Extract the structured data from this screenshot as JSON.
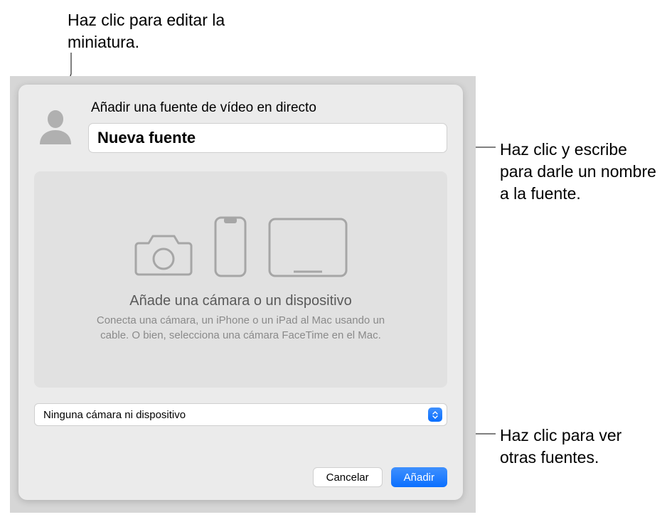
{
  "callouts": {
    "top": "Haz clic para editar la miniatura.",
    "right1": "Haz clic y escribe para darle un nombre a la fuente.",
    "right2": "Haz clic para ver otras fuentes."
  },
  "dialog": {
    "title": "Añadir una fuente de vídeo en directo",
    "name_value": "Nueva fuente",
    "preview_heading": "Añade una cámara o un dispositivo",
    "preview_sub": "Conecta una cámara, un iPhone o un iPad al Mac usando un cable. O bien, selecciona una cámara FaceTime en el Mac.",
    "dropdown_value": "Ninguna cámara ni dispositivo",
    "cancel_label": "Cancelar",
    "add_label": "Añadir"
  }
}
